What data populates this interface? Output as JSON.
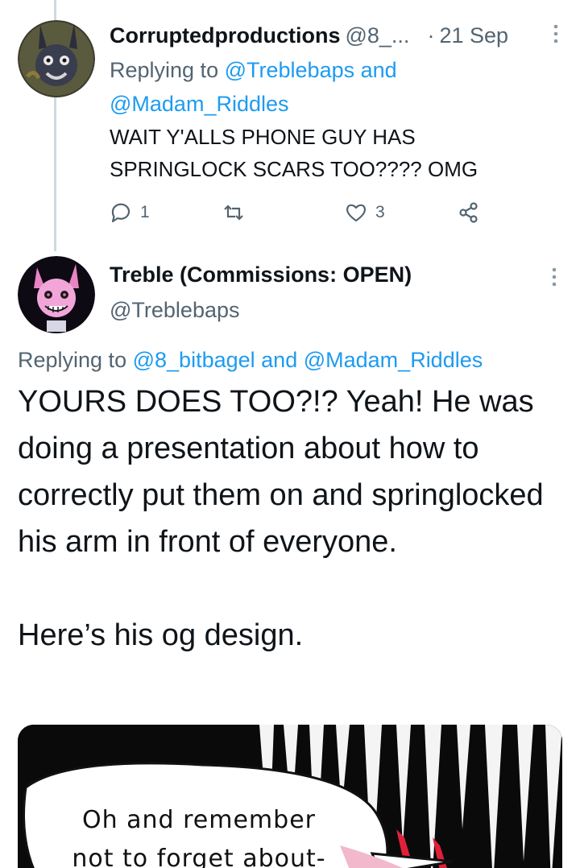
{
  "reply_tweet": {
    "display_name": "Corruptedproductions",
    "handle": "@8_...",
    "separator": "·",
    "date": "21 Sep",
    "replying_prefix": "Replying to",
    "mention_1": "@Treblebaps",
    "and_word": "and",
    "mention_2": "@Madam_Riddles",
    "text_line_1": "WAIT Y'ALLS PHONE GUY HAS",
    "text_line_2": "SPRINGLOCK SCARS TOO???? OMG",
    "reply_count": "1",
    "retweet_count": "",
    "like_count": "3",
    "icons": {
      "reply": "reply-icon",
      "retweet": "retweet-icon",
      "like": "heart-icon",
      "share": "share-icon",
      "more": "more-vertical-icon"
    }
  },
  "main_tweet": {
    "display_name": "Treble (Commissions: OPEN)",
    "handle": "@Treblebaps",
    "replying_prefix": "Replying to",
    "mention_1": "@8_bitbagel",
    "and_word": "and",
    "mention_2": "@Madam_Riddles",
    "text_paragraph_1": "YOURS DOES TOO?!? Yeah! He was doing a presentation about how to correctly put them on and springlocked his arm in front of everyone.",
    "text_paragraph_2": "Here’s his og design.",
    "media": {
      "speech_line_1": "Oh and remember",
      "speech_line_2": "not to forget about-"
    }
  },
  "colors": {
    "text_primary": "#0f1419",
    "text_muted": "#536471",
    "link_blue": "#1d9bf0",
    "thread_line": "#cfd9de"
  }
}
